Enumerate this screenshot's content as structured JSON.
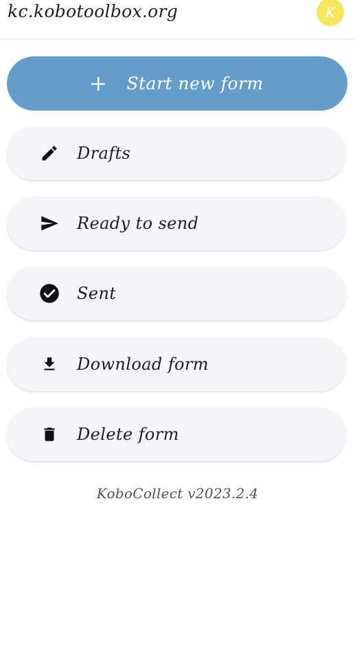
{
  "header": {
    "server": "kc.kobotoolbox.org",
    "avatar_letter": "K",
    "avatar_color": "#f5e65a"
  },
  "start_button": {
    "label": "Start new form",
    "icon": "plus-icon",
    "color": "#649dc9"
  },
  "menu": [
    {
      "label": "Drafts",
      "icon": "pencil-icon"
    },
    {
      "label": "Ready to send",
      "icon": "send-icon"
    },
    {
      "label": "Sent",
      "icon": "check-circle-icon"
    },
    {
      "label": "Download form",
      "icon": "download-icon"
    },
    {
      "label": "Delete form",
      "icon": "trash-icon"
    }
  ],
  "footer": {
    "version": "KoboCollect v2023.2.4"
  }
}
